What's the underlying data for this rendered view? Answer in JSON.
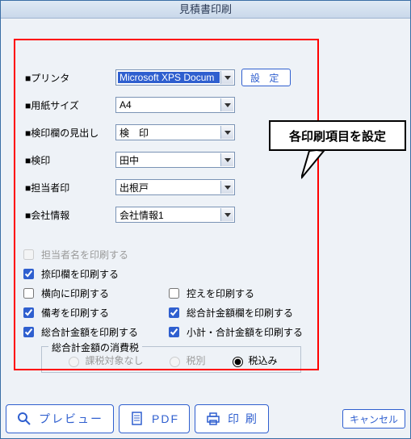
{
  "window": {
    "title": "見積書印刷"
  },
  "callout": {
    "text": "各印刷項目を設定"
  },
  "form": {
    "printer": {
      "label": "■プリンタ",
      "value": "Microsoft XPS Docum"
    },
    "settings_btn": "設 定",
    "paper": {
      "label": "■用紙サイズ",
      "value": "A4"
    },
    "stamp_header": {
      "label": "■検印欄の見出し",
      "value": "検　印"
    },
    "stamp": {
      "label": "■検印",
      "value": "田中"
    },
    "person_stamp": {
      "label": "■担当者印",
      "value": "出根戸"
    },
    "company_info": {
      "label": "■会社情報",
      "value": "会社情報1"
    }
  },
  "options": {
    "print_person_name": {
      "label": "担当者名を印刷する",
      "checked": false,
      "disabled": true
    },
    "print_stamp_box": {
      "label": "捺印欄を印刷する",
      "checked": true
    },
    "landscape": {
      "label": "横向に印刷する",
      "checked": false
    },
    "print_copy": {
      "label": "控えを印刷する",
      "checked": false
    },
    "print_notes": {
      "label": "備考を印刷する",
      "checked": true
    },
    "print_total_box": {
      "label": "総合計金額欄を印刷する",
      "checked": true
    },
    "print_total": {
      "label": "総合計金額を印刷する",
      "checked": true
    },
    "print_subtotal": {
      "label": "小計・合計金額を印刷する",
      "checked": true
    }
  },
  "tax": {
    "legend": "総合計金額の消費税",
    "none": {
      "label": "課税対象なし",
      "disabled": true
    },
    "excl": {
      "label": "税別",
      "disabled": true
    },
    "incl": {
      "label": "税込み",
      "checked": true
    }
  },
  "footer": {
    "preview": "プレビュー",
    "pdf": "PDF",
    "print": "印 刷",
    "cancel": "キャンセル"
  }
}
